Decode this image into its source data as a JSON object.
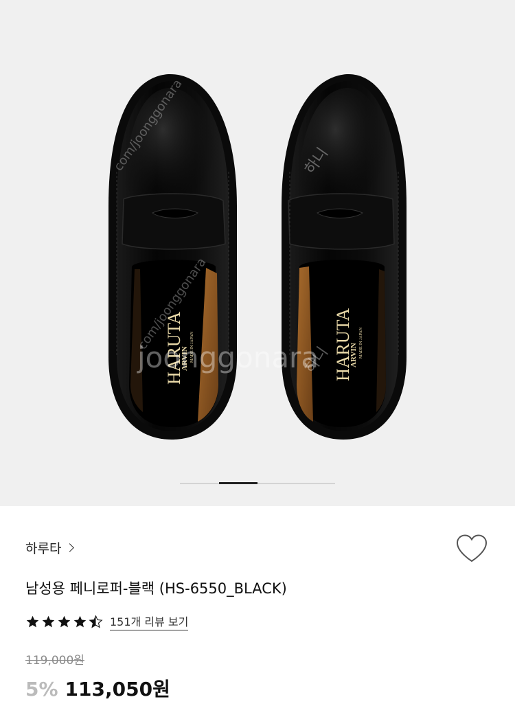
{
  "gallery": {
    "insole_brand": "HARUTA",
    "insole_sub": "ARVIN",
    "insole_origin": "MADE IN JAPAN",
    "watermark_main": "joonggonara",
    "watermark_url": "com/joonggonara",
    "watermark_user": "하니",
    "slide_current": 2,
    "slide_total": 4
  },
  "product": {
    "brand": "하루타",
    "name": "남성용 페니로퍼-블랙 (HS-6550_BLACK)",
    "rating": 4.5,
    "review_link": "151개 리뷰 보기",
    "original_price": "119,000원",
    "discount": "5%",
    "sale_price": "113,050원"
  },
  "colors": {
    "background": "#f0f0f0",
    "discount_text": "#bbbbbb",
    "text": "#111111"
  }
}
